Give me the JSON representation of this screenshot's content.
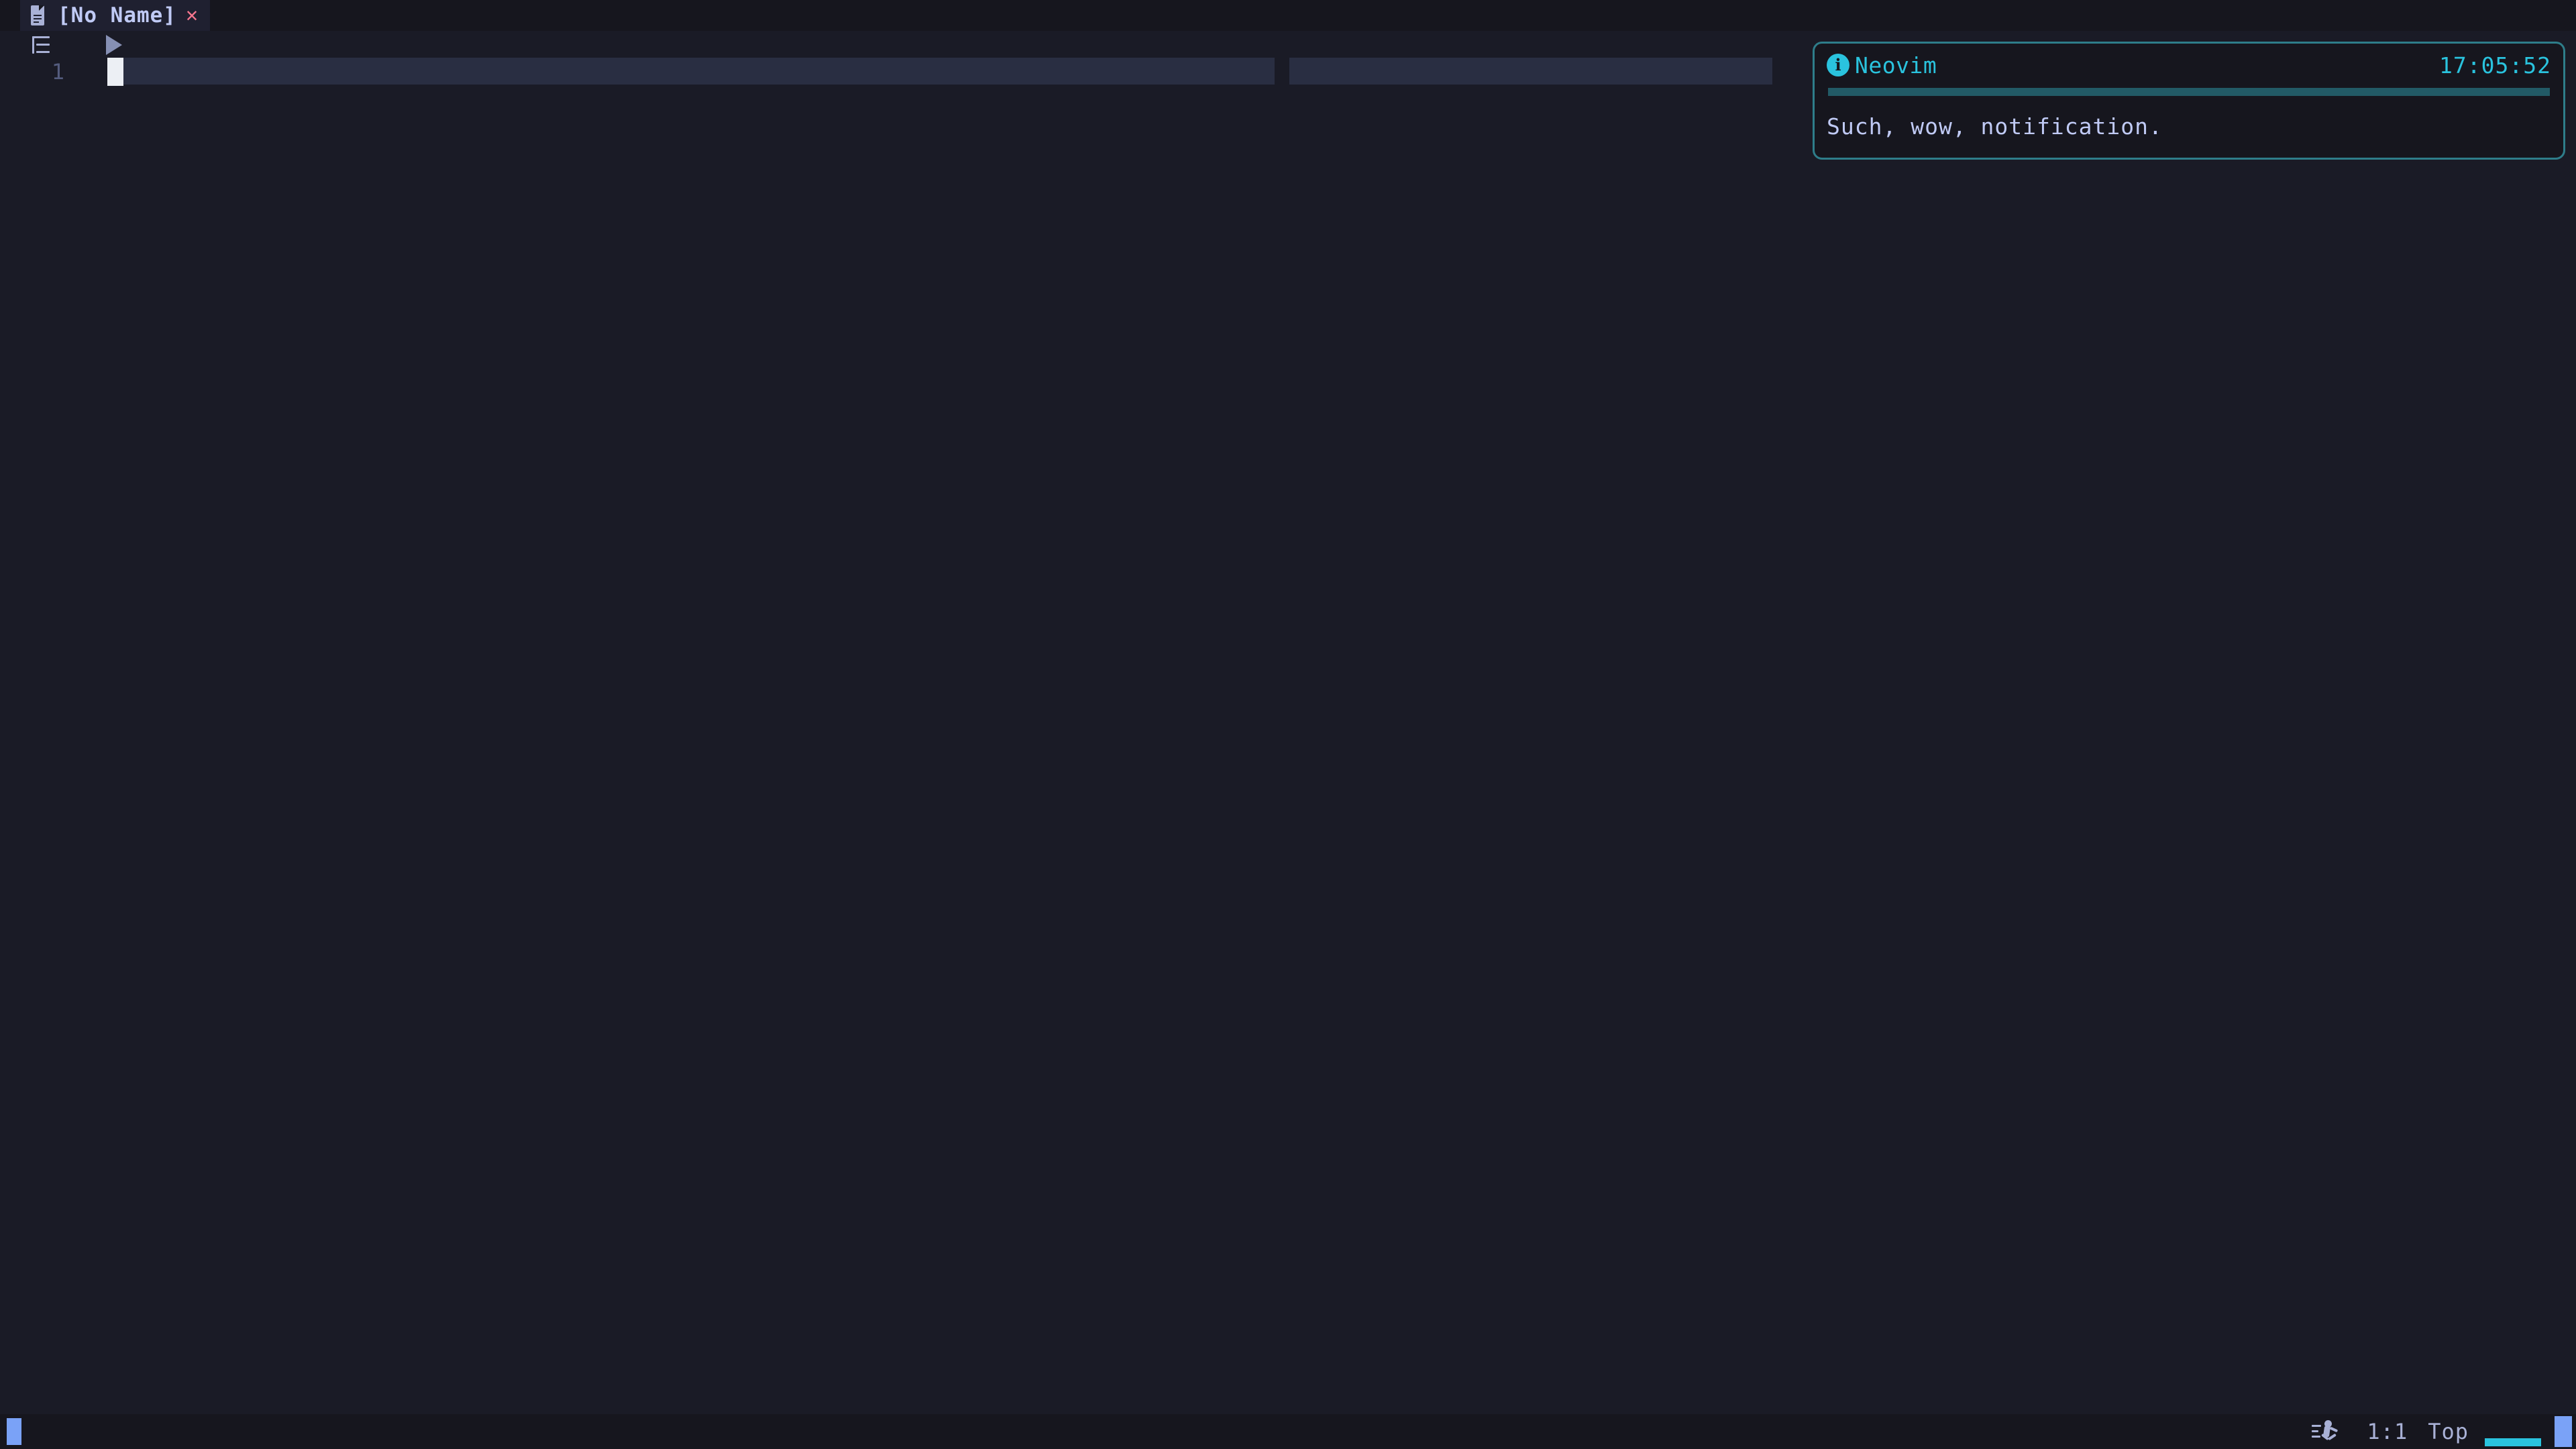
{
  "editor": {
    "name": "Neovim",
    "background": "#1a1b26",
    "accent_cyan": "#2ac3de",
    "accent_blue": "#7aa2f7",
    "accent_red": "#f7768e",
    "text_color": "#c0caf5"
  },
  "tabline": {
    "buffer": {
      "icon": "file-icon",
      "label": "[No Name]",
      "close": "✕"
    }
  },
  "gutter": {
    "outline_icon": "outline-icon",
    "play_icon": "play-icon",
    "line_number": "1"
  },
  "notification": {
    "icon": "info-icon",
    "icon_glyph": "i",
    "title": "Neovim",
    "time": "17:05:52",
    "body": "Such, wow, notification.",
    "border_color": "#2e7d8a",
    "divider_color": "#225a66"
  },
  "statusline": {
    "mode_indicator": "mode-block",
    "run_icon": "run-icon",
    "position": "1:1",
    "location": "Top"
  }
}
